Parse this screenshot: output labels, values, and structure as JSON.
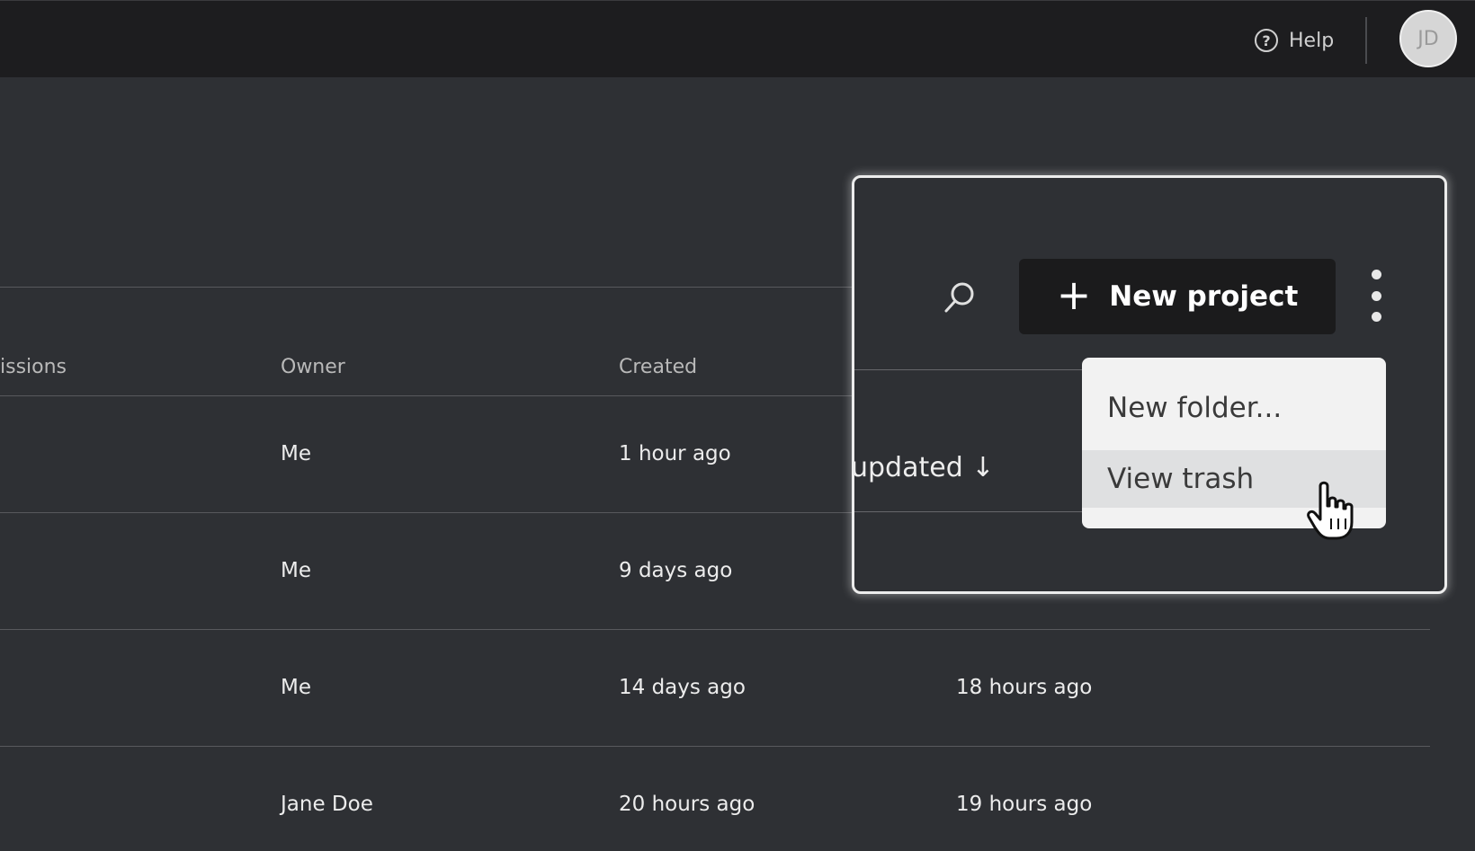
{
  "topbar": {
    "help_label": "Help",
    "avatar_initials": "JD"
  },
  "table": {
    "headers": {
      "permissions": "issions",
      "owner": "Owner",
      "created": "Created",
      "updated": "updated"
    },
    "rows": [
      {
        "owner": "Me",
        "created": "1 hour ago",
        "updated": ""
      },
      {
        "owner": "Me",
        "created": "9 days ago",
        "updated": ""
      },
      {
        "owner": "Me",
        "created": "14 days ago",
        "updated": "18 hours ago"
      },
      {
        "owner": "Jane Doe",
        "created": "20 hours ago",
        "updated": "19 hours ago"
      }
    ]
  },
  "toolbar": {
    "new_project_label": "New project",
    "search_icon": "search-icon",
    "more_icon": "kebab-menu-icon"
  },
  "menu": {
    "items": [
      "New folder...",
      "View trash"
    ],
    "hovered": "View trash"
  },
  "sort": {
    "label": "updated",
    "arrow": "↓"
  },
  "colors": {
    "background": "#2e3034",
    "topbar": "#1d1d1f",
    "button": "#1b1b1c",
    "menu": "#f2f2f2"
  }
}
